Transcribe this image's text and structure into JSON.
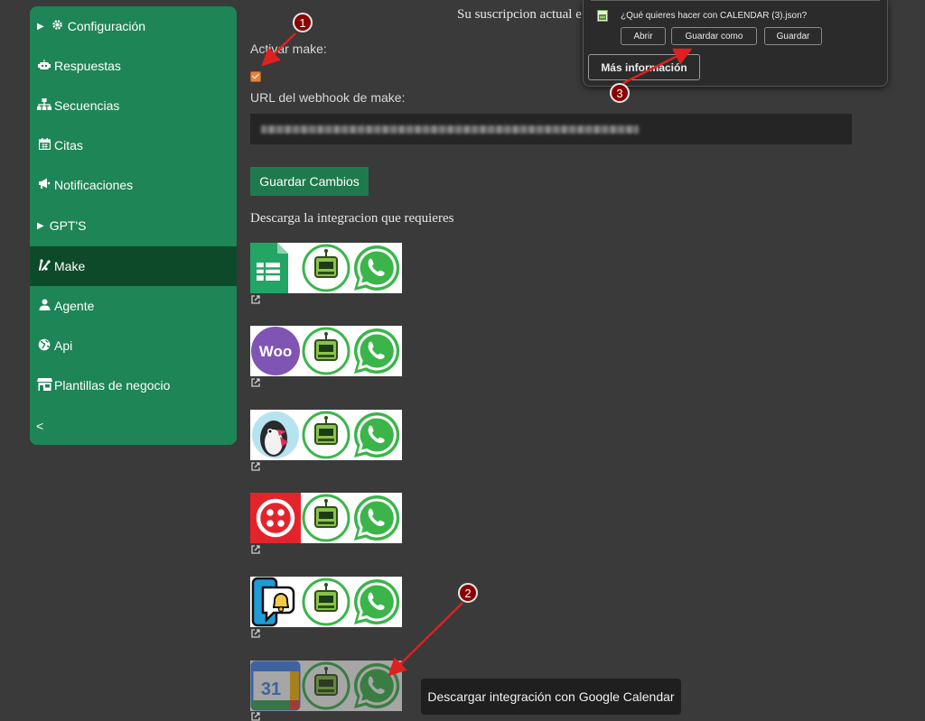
{
  "sidebar": {
    "items": [
      {
        "label": "Configuración",
        "icon": "gear-icon",
        "caret": "▶"
      },
      {
        "label": "Respuestas",
        "icon": "robot-icon",
        "caret": ""
      },
      {
        "label": "Secuencias",
        "icon": "sitemap-icon",
        "caret": ""
      },
      {
        "label": "Citas",
        "icon": "calendar-icon",
        "caret": ""
      },
      {
        "label": "Notificaciones",
        "icon": "bullhorn-icon",
        "caret": ""
      },
      {
        "label": "GPT'S",
        "icon": "",
        "caret": "▶"
      },
      {
        "label": "Make",
        "icon": "make-icon",
        "caret": ""
      },
      {
        "label": "Agente",
        "icon": "user-icon",
        "caret": ""
      },
      {
        "label": "Api",
        "icon": "globe-icon",
        "caret": ""
      },
      {
        "label": "Plantillas de negocio",
        "icon": "store-icon",
        "caret": ""
      }
    ],
    "collapse_label": "<",
    "active_item": "Make"
  },
  "main": {
    "subscription_text": "Su suscripcion actual e",
    "activate_label": "Activar make:",
    "activate_checked": true,
    "webhook_label": "URL del webhook de make:",
    "save_button": "Guardar Cambios",
    "download_title": "Descarga la integracion que requieres",
    "integrations": [
      {
        "name": "google-sheets",
        "icon": "google-sheets-icon"
      },
      {
        "name": "woocommerce",
        "icon": "woocommerce-icon",
        "logo_text": "Woo"
      },
      {
        "name": "prestashop",
        "icon": "prestashop-icon"
      },
      {
        "name": "twilio",
        "icon": "twilio-icon"
      },
      {
        "name": "notifications",
        "icon": "notification-bell-icon"
      },
      {
        "name": "google-calendar",
        "icon": "google-calendar-icon",
        "logo_text": "31"
      }
    ]
  },
  "download_popup": {
    "question": "¿Qué quieres hacer con CALENDAR (3).json?",
    "buttons": [
      "Abrir",
      "Guardar como",
      "Guardar"
    ],
    "more_info": "Más información"
  },
  "tooltip": "Descargar integración con Google Calendar",
  "annotations": [
    "1",
    "2",
    "3"
  ],
  "colors": {
    "sidebar": "#1e8556",
    "sidebar_active": "#0c4a2a",
    "background": "#3a3a3a",
    "button": "#1e7a4c",
    "annotation": "#8b0000",
    "arrow": "#e02020"
  }
}
